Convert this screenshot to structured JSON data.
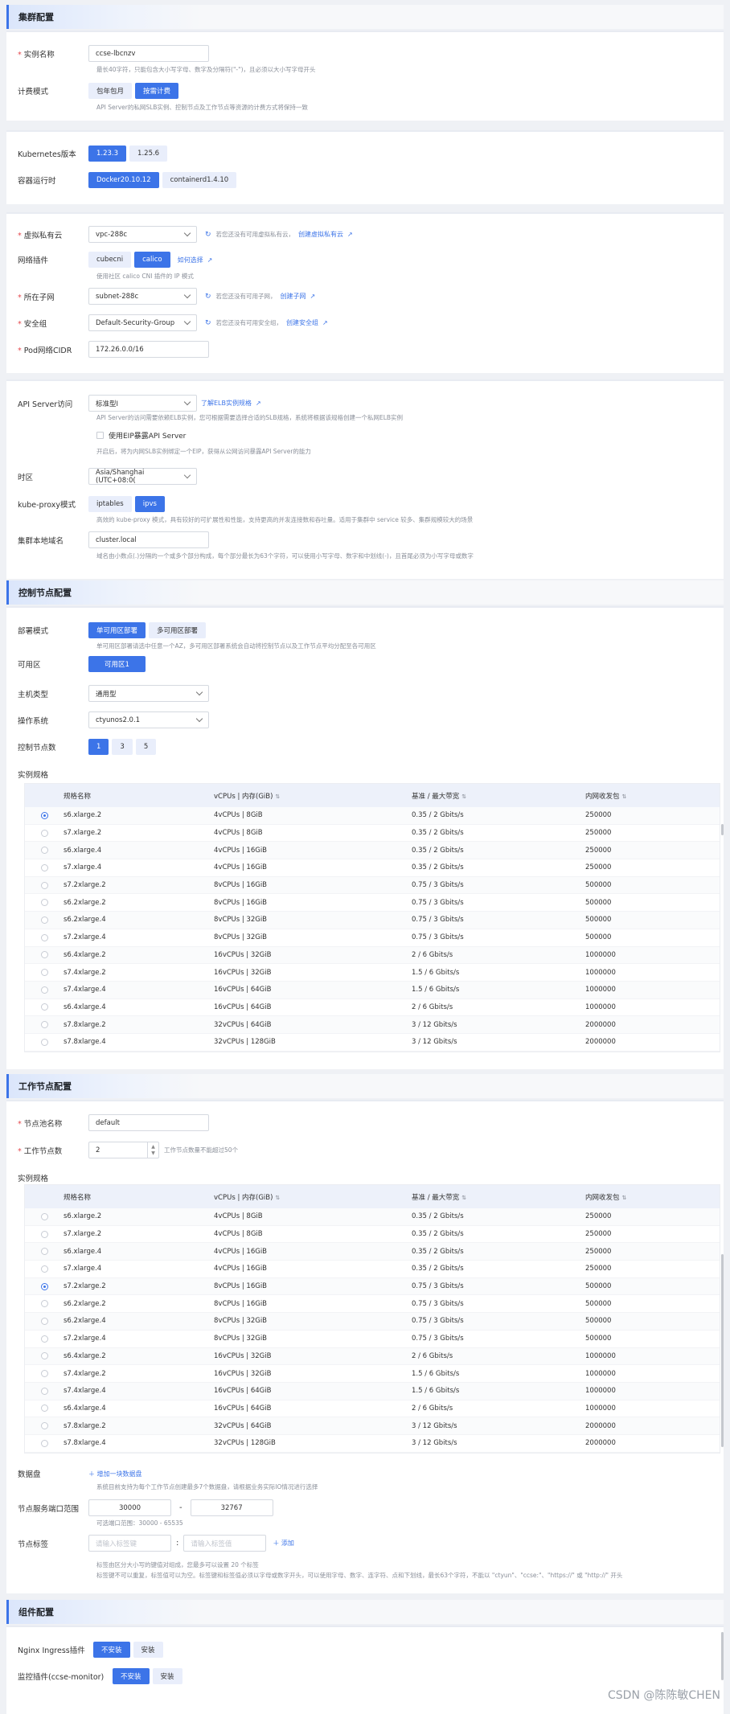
{
  "cluster": {
    "title": "集群配置",
    "instance_name_label": "实例名称",
    "instance_name_value": "ccse-lbcnzv",
    "instance_name_hint": "最长40字符，只能包含大小写字母、数字及分隔符(\"-\")，且必须以大小写字母开头",
    "billing_label": "计费模式",
    "billing_options": [
      "包年包月",
      "按需计费"
    ],
    "billing_hint": "API Server的私网SLB实例、控制节点及工作节点等资源的计费方式将保持一致",
    "k8s_label": "Kubernetes版本",
    "k8s_options": [
      "1.23.3",
      "1.25.6"
    ],
    "runtime_label": "容器运行时",
    "runtime_options": [
      "Docker20.10.12",
      "containerd1.4.10"
    ],
    "vpc_label": "虚拟私有云",
    "vpc_value": "vpc-288c",
    "vpc_note": "若您还没有可用虚拟私有云，",
    "vpc_link": "创建虚拟私有云",
    "network_label": "网络插件",
    "network_options": [
      "cubecni",
      "calico"
    ],
    "network_link": "如何选择",
    "network_hint": "使用社区 calico CNI 插件的 IP 模式",
    "subnet_label": "所在子网",
    "subnet_value": "subnet-288c",
    "subnet_note": "若您还没有可用子网，",
    "subnet_link": "创建子网",
    "sg_label": "安全组",
    "sg_value": "Default-Security-Group",
    "sg_note": "若您还没有可用安全组，",
    "sg_link": "创建安全组",
    "pod_cidr_label": "Pod网络CIDR",
    "pod_cidr_value": "172.26.0.0/16",
    "api_label": "API Server访问",
    "api_value": "标准型I",
    "api_link": "了解ELB实例规格",
    "api_hint": "API Server的访问需要依赖ELB实例，您可根据需要选择合适的SLB规格，系统将根据该规格创建一个私网ELB实例",
    "eip_label": "使用EIP暴露API Server",
    "eip_hint": "开启后，将为内网SLB实例绑定一个EIP，获得从公网访问暴露API Server的能力",
    "tz_label": "时区",
    "tz_value": "Asia/Shanghai (UTC+08:0(",
    "kp_label": "kube-proxy模式",
    "kp_options": [
      "iptables",
      "ipvs"
    ],
    "kp_hint": "高效的 kube-proxy 模式，具有较好的可扩展性和性能，支持更高的并发连接数和吞吐量。适用于集群中 service 较多、集群规模较大的场景",
    "domain_label": "集群本地域名",
    "domain_value": "cluster.local",
    "domain_hint": "域名由小数点(.)分隔的一个或多个部分构成，每个部分最长为63个字符，可以使用小写字母、数字和中划线(-)，且首尾必须为小写字母或数字"
  },
  "control": {
    "title": "控制节点配置",
    "deploy_label": "部署模式",
    "deploy_options": [
      "单可用区部署",
      "多可用区部署"
    ],
    "deploy_hint": "单可用区部署请选中任意一个AZ，多可用区部署系统会自动将控制节点以及工作节点平均分配至各可用区",
    "az_label": "可用区",
    "az_value": "可用区1",
    "host_label": "主机类型",
    "host_value": "通用型",
    "os_label": "操作系统",
    "os_value": "ctyunos2.0.1",
    "count_label": "控制节点数",
    "count_options": [
      "1",
      "3",
      "5"
    ],
    "spec_label": "实例规格",
    "selected_index": 0
  },
  "spec_table": {
    "headers": [
      "规格名称",
      "vCPUs | 内存(GiB)",
      "基准 / 最大带宽",
      "内网收发包"
    ],
    "rows": [
      [
        "s6.xlarge.2",
        "4vCPUs | 8GiB",
        "0.35 / 2 Gbits/s",
        "250000"
      ],
      [
        "s7.xlarge.2",
        "4vCPUs | 8GiB",
        "0.35 / 2 Gbits/s",
        "250000"
      ],
      [
        "s6.xlarge.4",
        "4vCPUs | 16GiB",
        "0.35 / 2 Gbits/s",
        "250000"
      ],
      [
        "s7.xlarge.4",
        "4vCPUs | 16GiB",
        "0.35 / 2 Gbits/s",
        "250000"
      ],
      [
        "s7.2xlarge.2",
        "8vCPUs | 16GiB",
        "0.75 / 3 Gbits/s",
        "500000"
      ],
      [
        "s6.2xlarge.2",
        "8vCPUs | 16GiB",
        "0.75 / 3 Gbits/s",
        "500000"
      ],
      [
        "s6.2xlarge.4",
        "8vCPUs | 32GiB",
        "0.75 / 3 Gbits/s",
        "500000"
      ],
      [
        "s7.2xlarge.4",
        "8vCPUs | 32GiB",
        "0.75 / 3 Gbits/s",
        "500000"
      ],
      [
        "s6.4xlarge.2",
        "16vCPUs | 32GiB",
        "2 / 6 Gbits/s",
        "1000000"
      ],
      [
        "s7.4xlarge.2",
        "16vCPUs | 32GiB",
        "1.5 / 6 Gbits/s",
        "1000000"
      ],
      [
        "s7.4xlarge.4",
        "16vCPUs | 64GiB",
        "1.5 / 6 Gbits/s",
        "1000000"
      ],
      [
        "s6.4xlarge.4",
        "16vCPUs | 64GiB",
        "2 / 6 Gbits/s",
        "1000000"
      ],
      [
        "s7.8xlarge.2",
        "32vCPUs | 64GiB",
        "3 / 12 Gbits/s",
        "2000000"
      ],
      [
        "s7.8xlarge.4",
        "32vCPUs | 128GiB",
        "3 / 12 Gbits/s",
        "2000000"
      ]
    ]
  },
  "worker": {
    "title": "工作节点配置",
    "pool_label": "节点池名称",
    "pool_value": "default",
    "count_label": "工作节点数",
    "count_value": "2",
    "count_hint": "工作节点数量不能超过50个",
    "spec_label": "实例规格",
    "selected_index": 4,
    "disk_label": "数据盘",
    "disk_link": "＋ 增加一块数据盘",
    "disk_hint": "系统目前支持为每个工作节点创建最多7个数据盘，请根据业务实际IO情况进行选择",
    "port_label": "节点服务端口范围",
    "port_min": "30000",
    "port_max": "32767",
    "port_sep": "-",
    "port_hint": "可选端口范围：30000 - 65535",
    "tag_label": "节点标签",
    "tag_key_placeholder": "请输入标签键",
    "tag_val_placeholder": "请输入标签值",
    "tag_sep": ":",
    "tag_add": "＋ 添加",
    "tag_hint1": "标签由区分大小写的键值对组成，您最多可以设置 20 个标签",
    "tag_hint2": "标签键不可以重复，标签值可以为空。标签键和标签值必须以字母或数字开头，可以使用字母、数字、连字符、点和下划线，最长63个字符，不能以 \"ctyun\"、\"ccse:\"、\"https://\" 或 \"http://\" 开头"
  },
  "components": {
    "title": "组件配置",
    "nginx_label": "Nginx Ingress插件",
    "nginx_options": [
      "不安装",
      "安装"
    ],
    "monitor_label": "监控插件(ccse-monitor)",
    "monitor_options": [
      "不安装",
      "安装"
    ]
  },
  "watermark": "CSDN @陈陈敏CHEN"
}
